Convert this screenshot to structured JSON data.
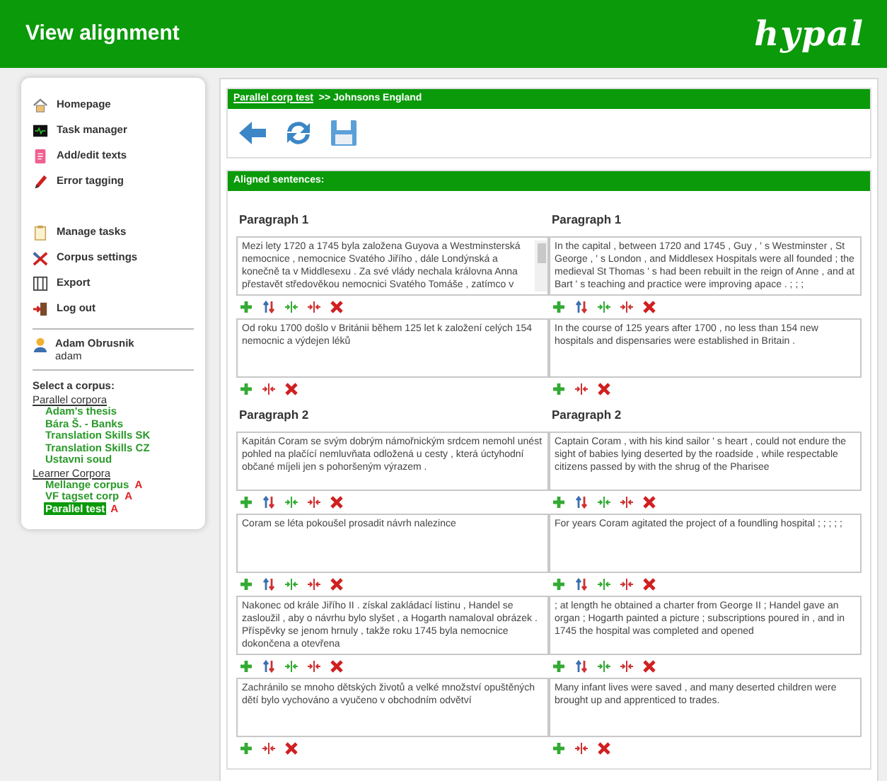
{
  "header": {
    "title": "View alignment",
    "logo": "hypal"
  },
  "sidebar": {
    "menu": [
      {
        "label": "Homepage"
      },
      {
        "label": "Task manager"
      },
      {
        "label": "Add/edit texts"
      },
      {
        "label": "Error tagging"
      }
    ],
    "menu2": [
      {
        "label": "Manage tasks"
      },
      {
        "label": "Corpus settings"
      },
      {
        "label": "Export"
      },
      {
        "label": "Log out"
      }
    ],
    "user": {
      "name": "Adam Obrusnik",
      "login": "adam"
    },
    "corpus_prompt": "Select a corpus:",
    "corpus_groups": [
      {
        "title": "Parallel corpora",
        "items": [
          {
            "label": "Adam's thesis",
            "selected": false
          },
          {
            "label": "Bára Š. - Banks",
            "selected": false
          },
          {
            "label": "Translation Skills SK",
            "selected": false
          },
          {
            "label": "Translation Skills CZ",
            "selected": false
          },
          {
            "label": "Ustavni soud",
            "selected": false
          }
        ]
      },
      {
        "title": "Learner Corpora",
        "items": [
          {
            "label": "Mellange corpus",
            "selected": false,
            "badge": "A"
          },
          {
            "label": "VF tagset corp",
            "selected": false,
            "badge": "A"
          },
          {
            "label": "Parallel test",
            "selected": true,
            "badge": "A"
          }
        ]
      }
    ]
  },
  "breadcrumb": {
    "link": "Parallel corp test",
    "rest": ">> Johnsons England"
  },
  "aligned_title": "Aligned sentences:",
  "paragraphs": [
    {
      "left_title": "Paragraph 1",
      "right_title": "Paragraph 1",
      "rows": [
        {
          "left": {
            "text": "Mezi lety 1720 a 1745 byla založena Guyova a Westminsterská nemocnice , nemocnice Svatého Jiřího , dále Londýnská a konečně ta v Middlesexu . Za své vlády nechala královna Anna přestavět středověkou nemocnici Svatého Tomáše , zatímco v",
            "scrollable": true
          },
          "right": {
            "text": "In the capital , between 1720 and 1745 , Guy , ' s Westminster , St George , ' s London , and Middlesex Hospitals were all founded ; the medieval St Thomas ' s had been rebuilt in the reign of Anne , and at Bart ' s teaching and practice were improving apace . ; ; ;",
            "scrollable": false
          }
        },
        {
          "left": {
            "text": "Od roku 1700 došlo v Británii během 125 let k založení celých 154 nemocnic a výdejen léků",
            "scrollable": false
          },
          "right": {
            "text": "In the course of 125 years after 1700 , no less than 154 new hospitals and dispensaries were established in Britain .",
            "scrollable": false
          }
        }
      ]
    },
    {
      "left_title": "Paragraph 2",
      "right_title": "Paragraph 2",
      "rows": [
        {
          "left": {
            "text": "Kapitán Coram se svým dobrým námořnickým srdcem nemohl unést pohled na plačící nemluvňata odložená u cesty , která úctyhodní občané míjeli jen s pohoršeným výrazem .",
            "scrollable": false
          },
          "right": {
            "text": "Captain Coram , with his kind sailor ' s heart , could not endure the sight of babies lying deserted by the roadside , while respectable citizens passed by with the shrug of the Pharisee",
            "scrollable": false
          }
        },
        {
          "left": {
            "text": "Coram se léta pokoušel prosadit návrh nalezince",
            "scrollable": false
          },
          "right": {
            "text": "For years Coram agitated the project of a foundling hospital ; ; ; ; ;",
            "scrollable": false
          }
        },
        {
          "left": {
            "text": "Nakonec od krále Jiřího II . získal zakládací listinu , Handel se zasloužil , aby o návrhu bylo slyšet , a Hogarth namaloval obrázek . Příspěvky se jenom hrnuly , takže roku 1745 byla nemocnice dokončena a otevřena",
            "scrollable": false
          },
          "right": {
            "text": "; at length he obtained a charter from George II ; Handel gave an organ ; Hogarth painted a picture ; subscriptions poured in , and in 1745 the hospital was completed and opened",
            "scrollable": false
          }
        },
        {
          "left": {
            "text": "Zachránilo se mnoho dětských životů a velké množství opuštěných dětí bylo vychováno a vyučeno v obchodním odvětví",
            "scrollable": false
          },
          "right": {
            "text": "Many infant lives were saved , and many deserted children were brought up and apprenticed to trades.",
            "scrollable": false
          }
        }
      ]
    }
  ]
}
